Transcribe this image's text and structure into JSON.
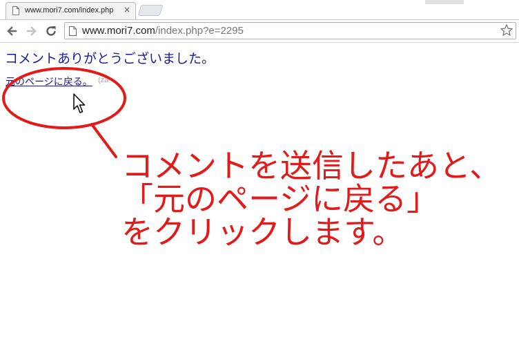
{
  "browser": {
    "tab": {
      "title": "www.mori7.com/index.php",
      "close_symbol": "×",
      "favicon": "page-icon"
    },
    "toolbar": {
      "back_icon": "back-arrow-icon",
      "forward_icon": "forward-arrow-icon",
      "reload_icon": "reload-icon",
      "url_host": "www.mori7.com",
      "url_path": "/index.php?e=2295",
      "bookmark_icon": "star-icon"
    }
  },
  "page": {
    "thanks_message": "コメントありがとうございました。",
    "back_link": "元のページに戻る。",
    "back_link_suffix": "(za-",
    "link_color": "#1a1aa6"
  },
  "annotation": {
    "lines": [
      "コメントを送信したあと、",
      "「元のページに戻る」",
      "をクリックします。"
    ],
    "color": "#e21a1a"
  }
}
